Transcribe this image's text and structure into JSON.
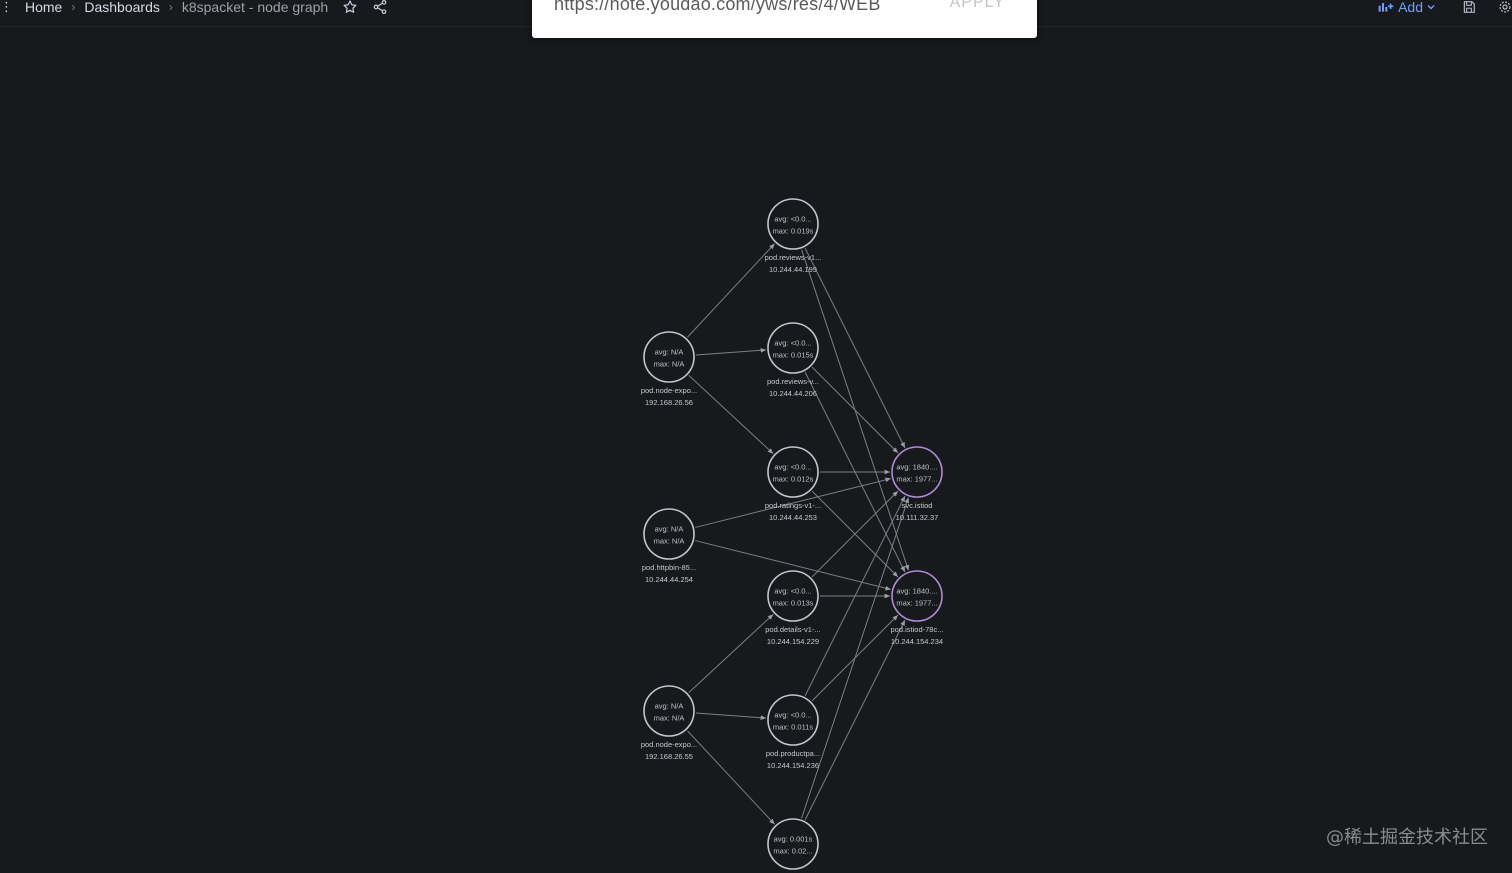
{
  "breadcrumb": {
    "home": "Home",
    "dashboards": "Dashboards",
    "current": "k8spacket - node graph"
  },
  "toolbar": {
    "add_label": "Add",
    "icons": [
      "star-icon",
      "share-icon",
      "add-panel-icon",
      "chevron-down-icon",
      "save-icon",
      "settings-icon"
    ]
  },
  "url_popup": {
    "url": "https://note.youdao.com/yws/res/4/WEB",
    "apply_label": "APPLY"
  },
  "node_graph": {
    "nodes": [
      {
        "id": "n1",
        "stat1": "avg: <0.0...",
        "stat2": "max: 0.019s",
        "title": "pod.reviews-v1...",
        "subtitle": "10.244.44.199",
        "kind": "pod"
      },
      {
        "id": "n2",
        "stat1": "avg: <0.0...",
        "stat2": "max: 0.015s",
        "title": "pod.reviews-v...",
        "subtitle": "10.244.44.206",
        "kind": "pod"
      },
      {
        "id": "n3",
        "stat1": "avg: <0.0...",
        "stat2": "max: 0.012s",
        "title": "pod.ratings-v1-...",
        "subtitle": "10.244.44.253",
        "kind": "pod"
      },
      {
        "id": "n4",
        "stat1": "avg: <0.0...",
        "stat2": "max: 0.013s",
        "title": "pod.details-v1-...",
        "subtitle": "10.244.154.229",
        "kind": "pod"
      },
      {
        "id": "n5",
        "stat1": "avg: <0.0...",
        "stat2": "max: 0.011s",
        "title": "pod.productpa...",
        "subtitle": "10.244.154.236",
        "kind": "pod"
      },
      {
        "id": "n6",
        "stat1": "avg: 0.001s",
        "stat2": "max: 0.02...",
        "title": "",
        "subtitle": "",
        "kind": "pod"
      },
      {
        "id": "s1",
        "stat1": "avg: N/A",
        "stat2": "max: N/A",
        "title": "pod.node-expo...",
        "subtitle": "192.168.26.56",
        "kind": "source"
      },
      {
        "id": "s2",
        "stat1": "avg: N/A",
        "stat2": "max: N/A",
        "title": "pod.httpbin-85...",
        "subtitle": "10.244.44.254",
        "kind": "source"
      },
      {
        "id": "s3",
        "stat1": "avg: N/A",
        "stat2": "max: N/A",
        "title": "pod.node-expo...",
        "subtitle": "192.168.26.55",
        "kind": "source"
      },
      {
        "id": "t1",
        "stat1": "avg: 1840....",
        "stat2": "max: 1977...",
        "title": "svc.istiod",
        "subtitle": "10.111.32.37",
        "kind": "svc"
      },
      {
        "id": "t2",
        "stat1": "avg: 1840....",
        "stat2": "max: 1977...",
        "title": "pod.istiod-78c...",
        "subtitle": "10.244.154.234",
        "kind": "svc"
      }
    ],
    "edges": [
      [
        "s1",
        "n1"
      ],
      [
        "s1",
        "n2"
      ],
      [
        "s1",
        "n3"
      ],
      [
        "s2",
        "t1"
      ],
      [
        "s2",
        "t2"
      ],
      [
        "s3",
        "n4"
      ],
      [
        "s3",
        "n5"
      ],
      [
        "s3",
        "n6"
      ],
      [
        "n1",
        "t1"
      ],
      [
        "n1",
        "t2"
      ],
      [
        "n2",
        "t1"
      ],
      [
        "n2",
        "t2"
      ],
      [
        "n3",
        "t1"
      ],
      [
        "n3",
        "t2"
      ],
      [
        "n4",
        "t1"
      ],
      [
        "n4",
        "t2"
      ],
      [
        "n5",
        "t1"
      ],
      [
        "n5",
        "t2"
      ],
      [
        "n6",
        "t1"
      ],
      [
        "n6",
        "t2"
      ]
    ]
  },
  "watermark": "@稀土掘金技术社区"
}
